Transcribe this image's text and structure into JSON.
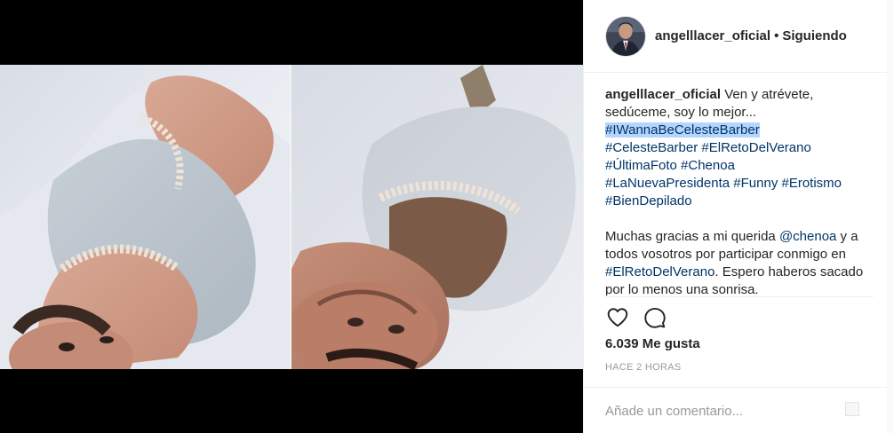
{
  "post": {
    "username": "angelllacer_oficial",
    "dot": "•",
    "follow_status": "Siguiendo"
  },
  "caption": {
    "username": "angelllacer_oficial",
    "intro": " Ven y atrévete, sedúceme, soy lo mejor... ",
    "hashtags": [
      "#IWannaBeCelesteBarber",
      "#CelesteBarber",
      "#ElRetoDelVerano",
      "#ÚltimaFoto",
      "#Chenoa",
      "#LaNuevaPresidenta",
      "#Funny",
      "#Erotismo",
      "#BienDepilado"
    ],
    "selected_hashtag_index": 0,
    "para_text_1": "Muchas gracias a mi querida ",
    "mention": "@chenoa",
    "para_text_2": " y a todos vosotros por participar conmigo en ",
    "para_hashtag": "#ElRetoDelVerano",
    "para_text_3": ". Espero haberos sacado por lo menos una sonrisa."
  },
  "actions": {
    "like_icon": "heart-icon",
    "comment_icon": "comment-icon"
  },
  "likes": "6.039 Me gusta",
  "timestamp": "HACE 2 HORAS",
  "comment": {
    "placeholder": "Añade un comentario...",
    "value": ""
  },
  "colors": {
    "text": "#262626",
    "hashtag": "#003569",
    "muted": "#999999",
    "border": "#efefef",
    "selection": "#b4d5fe",
    "media_bg": "#000000"
  }
}
